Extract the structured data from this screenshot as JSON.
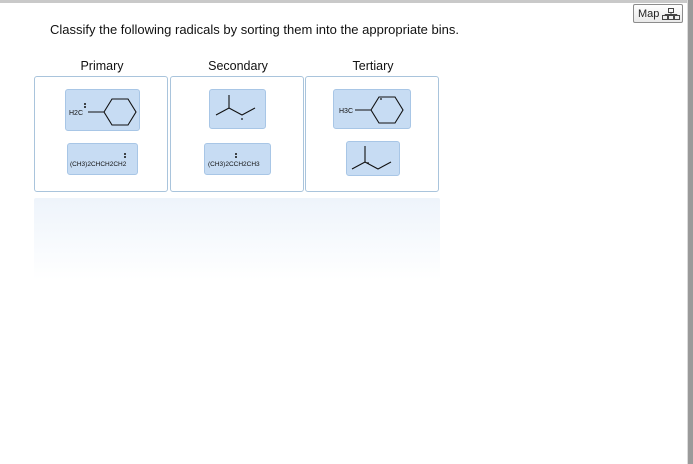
{
  "header": {
    "map_button_label": "Map",
    "map_icon": "sitemap-icon"
  },
  "instruction": "Classify the following radicals by sorting them into the appropriate bins.",
  "bins": [
    {
      "label": "Primary"
    },
    {
      "label": "Secondary"
    },
    {
      "label": "Tertiary"
    }
  ],
  "items": {
    "primary_1_label": "H2C",
    "primary_2_formula": "(CH3)2CHCH2CH2",
    "secondary_2_formula": "(CH3)2CCH2CH3",
    "tertiary_1_label": "H3C"
  },
  "colors": {
    "tile_fill": "#c7dcf3",
    "bin_border": "#a9c4dc"
  }
}
